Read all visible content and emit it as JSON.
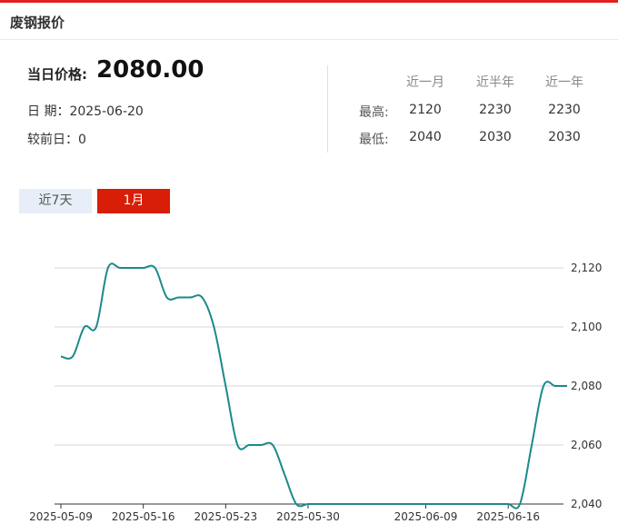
{
  "header": {
    "title": "废钢报价"
  },
  "summary": {
    "price_label": "当日价格:",
    "price_value": "2080.00",
    "date_text": "日 期：2025-06-20",
    "change_text": "较前日：0"
  },
  "stats": {
    "headers": [
      "近一月",
      "近半年",
      "近一年"
    ],
    "rows": [
      {
        "label": "最高:",
        "values": [
          "2120",
          "2230",
          "2230"
        ]
      },
      {
        "label": "最低:",
        "values": [
          "2040",
          "2030",
          "2030"
        ]
      }
    ]
  },
  "tabs": [
    {
      "label": "近7天",
      "active": false
    },
    {
      "label": "1月",
      "active": true
    }
  ],
  "colors": {
    "accent": "#d81e06",
    "line": "#1a8a8a"
  },
  "chart_data": {
    "type": "line",
    "x": [
      "2025-05-09",
      "2025-05-10",
      "2025-05-11",
      "2025-05-12",
      "2025-05-13",
      "2025-05-14",
      "2025-05-15",
      "2025-05-16",
      "2025-05-17",
      "2025-05-18",
      "2025-05-19",
      "2025-05-20",
      "2025-05-21",
      "2025-05-22",
      "2025-05-23",
      "2025-05-24",
      "2025-05-25",
      "2025-05-26",
      "2025-05-27",
      "2025-05-28",
      "2025-05-29",
      "2025-05-30",
      "2025-05-31",
      "2025-06-01",
      "2025-06-02",
      "2025-06-03",
      "2025-06-04",
      "2025-06-05",
      "2025-06-06",
      "2025-06-07",
      "2025-06-08",
      "2025-06-09",
      "2025-06-10",
      "2025-06-11",
      "2025-06-12",
      "2025-06-13",
      "2025-06-14",
      "2025-06-15",
      "2025-06-16",
      "2025-06-17",
      "2025-06-18",
      "2025-06-19",
      "2025-06-20"
    ],
    "series": [
      {
        "values": [
          2090,
          2090,
          2100,
          2100,
          2120,
          2120,
          2120,
          2120,
          2120,
          2110,
          2110,
          2110,
          2110,
          2100,
          2080,
          2060,
          2060,
          2060,
          2060,
          2050,
          2040,
          2040,
          2040,
          2040,
          2040,
          2040,
          2040,
          2040,
          2040,
          2040,
          2040,
          2040,
          2040,
          2040,
          2040,
          2040,
          2040,
          2040,
          2040,
          2040,
          2060,
          2080,
          2080,
          2080
        ]
      }
    ],
    "x_ticks": [
      "2025-05-09",
      "2025-05-16",
      "2025-05-23",
      "2025-05-30",
      "2025-06-09",
      "2025-06-16"
    ],
    "y_ticks": [
      "2,040",
      "2,060",
      "2,080",
      "2,100",
      "2,120"
    ],
    "ylim": [
      2040,
      2120
    ],
    "grid": true
  }
}
